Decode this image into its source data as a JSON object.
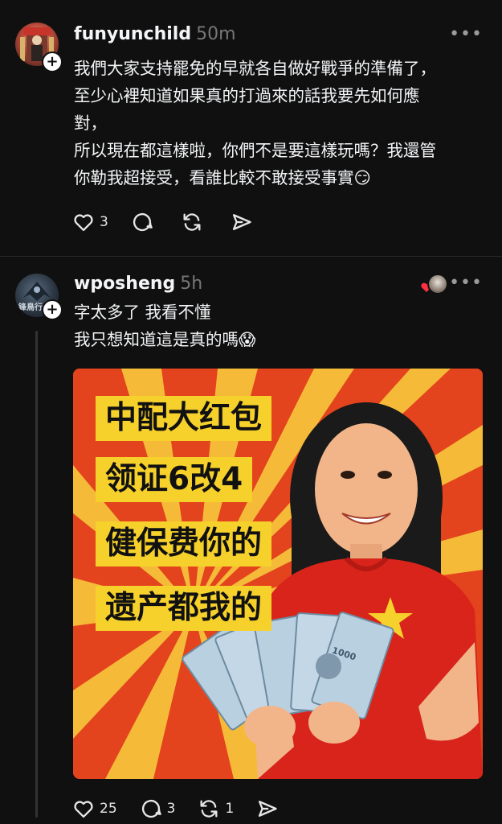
{
  "posts": [
    {
      "username": "funyunchild",
      "time": "50m",
      "more": "•••",
      "lines": [
        "我們大家支持罷免的早就各自做好戰爭的準備了，",
        "至少心裡知道如果真的打過來的話我要先如何應",
        "對，",
        "所以現在都這樣啦，你們不是要這樣玩嗎？我還管",
        "你勒我超接受，看誰比較不敢接受事實😏"
      ],
      "actions": {
        "likes": "3",
        "replies": "",
        "reposts": "",
        "share": ""
      }
    },
    {
      "username": "wposheng",
      "time": "5h",
      "more": "•••",
      "avatar_text": "锋鳥行",
      "lines": [
        "字太多了 我看不懂",
        "我只想知道這是真的嗎😱"
      ],
      "image": {
        "lines": [
          "中配大红包",
          "领证6改4",
          "健保费你的",
          "遗产都我的"
        ],
        "banknote_text": "1000"
      },
      "actions": {
        "likes": "25",
        "replies": "3",
        "reposts": "1",
        "share": ""
      }
    }
  ],
  "follow_icon": "+",
  "colors": {
    "background": "#101010",
    "text": "#f3f5f7",
    "muted": "#777777",
    "like_red": "#ff3040",
    "poster_red": "#e34a1f",
    "poster_yellow": "#f7d12b"
  },
  "icons": [
    "heart-icon",
    "comment-icon",
    "repost-icon",
    "share-icon",
    "more-icon",
    "plus-icon"
  ]
}
